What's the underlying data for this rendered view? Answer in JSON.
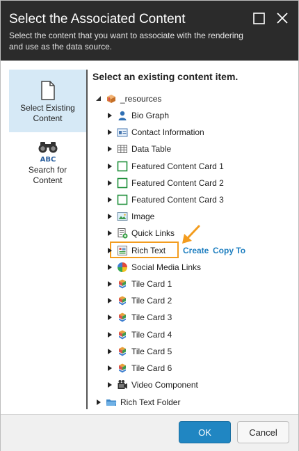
{
  "dialog": {
    "title": "Select the Associated Content",
    "subtitle": "Select the content that you want to associate with the rendering and use as the data source."
  },
  "sidebar": {
    "items": [
      {
        "label": "Select Existing Content",
        "icon": "document-icon",
        "active": true
      },
      {
        "label": "Search for Content",
        "icon": "binoculars-abc-icon",
        "icon_text": "ABC",
        "active": false
      }
    ]
  },
  "main": {
    "heading": "Select an existing content item."
  },
  "tree": {
    "root": {
      "label": "_resources",
      "icon": "box-icon",
      "expanded": true
    },
    "children": [
      {
        "label": "Bio Graph",
        "icon": "person-icon"
      },
      {
        "label": "Contact Information",
        "icon": "contact-card-icon"
      },
      {
        "label": "Data Table",
        "icon": "table-icon"
      },
      {
        "label": "Featured Content Card 1",
        "icon": "green-square-icon"
      },
      {
        "label": "Featured Content Card 2",
        "icon": "green-square-icon"
      },
      {
        "label": "Featured Content Card 3",
        "icon": "green-square-icon"
      },
      {
        "label": "Image",
        "icon": "image-icon"
      },
      {
        "label": "Quick Links",
        "icon": "quick-links-icon"
      },
      {
        "label": "Rich Text",
        "icon": "rich-text-icon",
        "selected": true
      },
      {
        "label": "Social Media Links",
        "icon": "color-wheel-icon"
      },
      {
        "label": "Tile Card 1",
        "icon": "tiles-icon"
      },
      {
        "label": "Tile Card 2",
        "icon": "tiles-icon"
      },
      {
        "label": "Tile Card 3",
        "icon": "tiles-icon"
      },
      {
        "label": "Tile Card 4",
        "icon": "tiles-icon"
      },
      {
        "label": "Tile Card 5",
        "icon": "tiles-icon"
      },
      {
        "label": "Tile Card 6",
        "icon": "tiles-icon"
      },
      {
        "label": "Video Component",
        "icon": "film-icon"
      }
    ],
    "sibling": {
      "label": "Rich Text Folder",
      "icon": "folder-icon"
    },
    "actions": {
      "create": "Create",
      "copy_to": "Copy To"
    }
  },
  "footer": {
    "ok_label": "OK",
    "cancel_label": "Cancel"
  },
  "colors": {
    "title_bar": "#2b2b2b",
    "accent_blue": "#2086c2",
    "link_blue": "#1f7fc0",
    "selection_orange": "#f39c1e",
    "sidebar_active": "#d6e9f6"
  }
}
